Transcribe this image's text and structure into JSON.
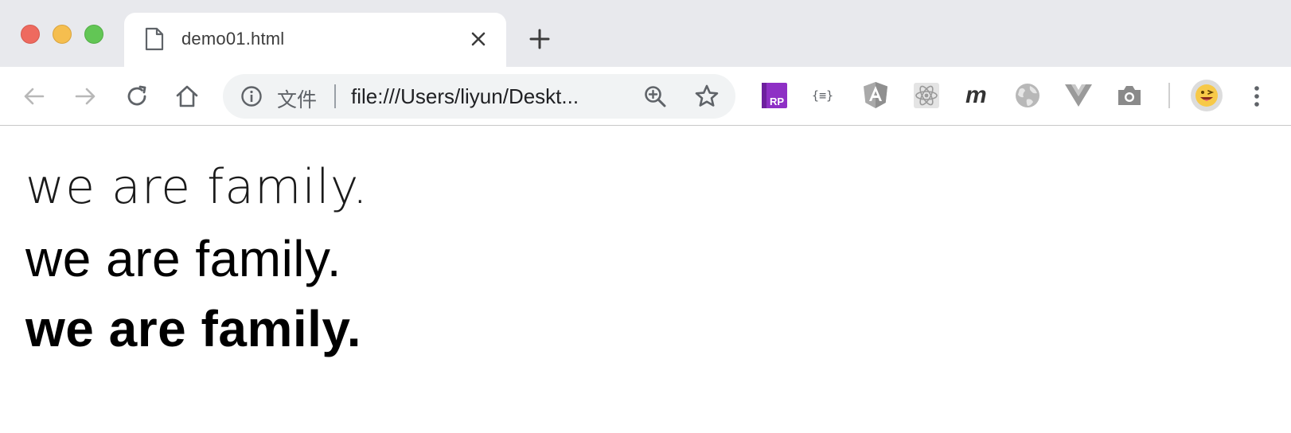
{
  "window": {
    "controls": [
      "close",
      "minimize",
      "maximize"
    ],
    "colors": {
      "close": "#ee6a5f",
      "minimize": "#f5be4f",
      "maximize": "#62c655"
    }
  },
  "tab": {
    "title": "demo01.html",
    "icon": "document-icon"
  },
  "toolbar": {
    "back_icon": "arrow-left-icon",
    "forward_icon": "arrow-right-icon",
    "reload_icon": "reload-icon",
    "home_icon": "home-icon"
  },
  "omnibox": {
    "scheme_label": "文件",
    "url": "file:///Users/liyun/Deskt...",
    "icons": [
      "info-icon",
      "zoom-in-icon",
      "star-icon"
    ]
  },
  "extensions": [
    {
      "name": "axure-rp-extension-icon",
      "label": "RP"
    },
    {
      "name": "json-formatter-icon",
      "label": "{≡}"
    },
    {
      "name": "angular-devtools-icon",
      "label": "A"
    },
    {
      "name": "react-devtools-icon",
      "label": ""
    },
    {
      "name": "mockplus-icon",
      "label": "m"
    },
    {
      "name": "globe-extension-icon",
      "label": ""
    },
    {
      "name": "vue-devtools-icon",
      "label": ""
    },
    {
      "name": "screenshot-camera-icon",
      "label": ""
    }
  ],
  "profile": {
    "avatar": "emoji-avatar"
  },
  "page": {
    "lines": [
      {
        "text": "we are family.",
        "weight": "thin"
      },
      {
        "text": "we are family.",
        "weight": "normal"
      },
      {
        "text": "we are family.",
        "weight": "bold"
      }
    ]
  }
}
